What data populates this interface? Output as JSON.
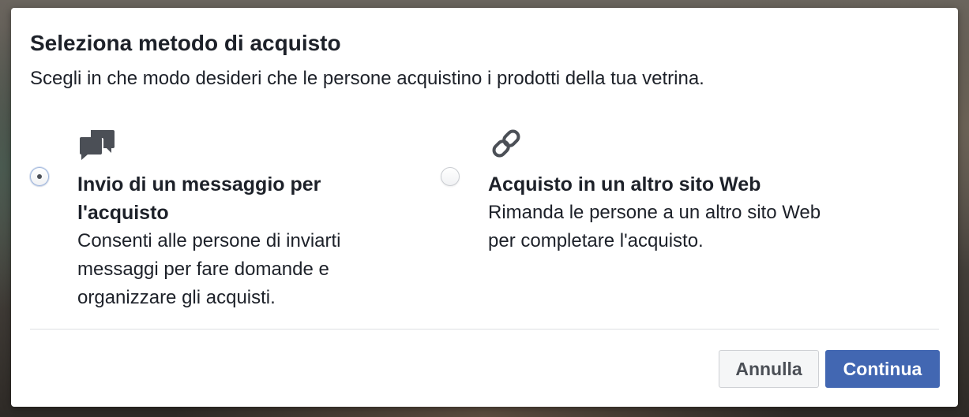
{
  "dialog": {
    "title": "Seleziona metodo di acquisto",
    "subtitle": "Scegli in che modo desideri che le persone acquistino i prodotti della tua vetrina."
  },
  "options": [
    {
      "icon": "chat-bubbles-icon",
      "title": "Invio di un messaggio per l'acquisto",
      "description": "Consenti alle persone di inviarti messaggi per fare domande e organizzare gli acquisti.",
      "selected": true
    },
    {
      "icon": "link-icon",
      "title": "Acquisto in un altro sito Web",
      "description": "Rimanda le persone a un altro sito Web per completare l'acquisto.",
      "selected": false
    }
  ],
  "footer": {
    "cancel_label": "Annulla",
    "continue_label": "Continua"
  },
  "colors": {
    "primary_button": "#4267b2",
    "text": "#1d2129",
    "icon": "#4b4f56"
  }
}
